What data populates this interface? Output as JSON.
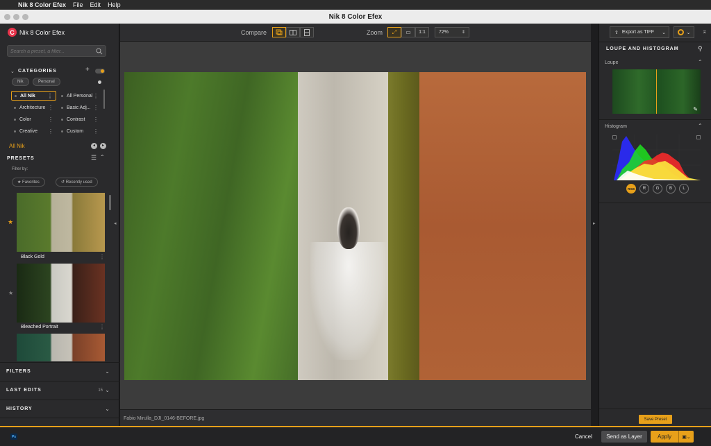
{
  "menubar": {
    "app": "Nik 8 Color Efex",
    "items": [
      "File",
      "Edit",
      "Help"
    ]
  },
  "window": {
    "title": "Nik 8 Color Efex"
  },
  "sidebar": {
    "brand": "Nik 8 Color Efex",
    "search_placeholder": "Search a preset, a filter...",
    "categories_title": "CATEGORIES",
    "chips": [
      "Nik",
      "Personal"
    ],
    "categories": [
      [
        "All Nik",
        "All Personal"
      ],
      [
        "Architecture",
        "Basic Adj..."
      ],
      [
        "Color",
        "Contrast"
      ],
      [
        "Creative",
        "Custom"
      ]
    ],
    "current_category": "All Nik",
    "presets_title": "PRESETS",
    "filter_by": "Filter by:",
    "filter_favorites": "Favorites",
    "filter_recent": "Recently used",
    "presets": [
      {
        "name": "Black Gold",
        "favorite": true
      },
      {
        "name": "Bleached Portrait",
        "favorite": false
      }
    ],
    "sections": {
      "filters": "FILTERS",
      "last_edits": "LAST EDITS",
      "last_edits_count": "15",
      "history": "HISTORY"
    }
  },
  "toolbar": {
    "compare_label": "Compare",
    "zoom_label": "Zoom",
    "zoom_1to1": "1:1",
    "zoom_value": "72%"
  },
  "image": {
    "filename": "Fabio Mirulla_DJI_0146-BEFORE.jpg"
  },
  "right": {
    "export_label": "Export as TIFF",
    "panel_title": "LOUPE AND HISTOGRAM",
    "loupe_label": "Loupe",
    "histogram_label": "Histogram",
    "channels": [
      "RGB",
      "R",
      "G",
      "B",
      "L"
    ],
    "save_preset": "Save Preset"
  },
  "bottom": {
    "ps": "Ps",
    "cancel": "Cancel",
    "send_layer": "Send as Layer",
    "apply": "Apply"
  },
  "colors": {
    "accent": "#e7a01a",
    "brand": "#e8334a"
  }
}
